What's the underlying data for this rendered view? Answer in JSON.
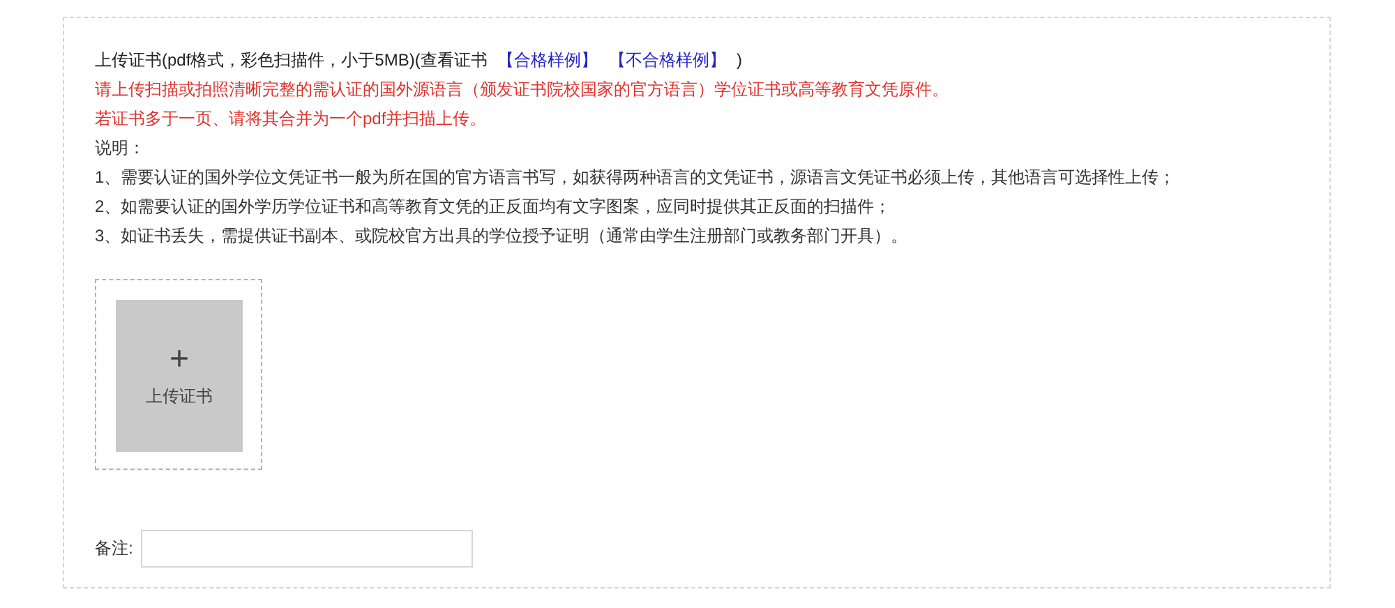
{
  "header": {
    "text": "上传证书(pdf格式，彩色扫描件，小于5MB)(查看证书",
    "links": [
      "【合格样例】",
      "【不合格样例】"
    ],
    "closing": ")"
  },
  "warnings": [
    "请上传扫描或拍照清晰完整的需认证的国外源语言（颁发证书院校国家的官方语言）学位证书或高等教育文凭原件。",
    "若证书多于一页、请将其合并为一个pdf并扫描上传。"
  ],
  "notes_title": "说明：",
  "notes": [
    "1、需要认证的国外学位文凭证书一般为所在国的官方语言书写，如获得两种语言的文凭证书，源语言文凭证书必须上传，其他语言可选择性上传；",
    "2、如需要认证的国外学历学位证书和高等教育文凭的正反面均有文字图案，应同时提供其正反面的扫描件；",
    "3、如证书丢失，需提供证书副本、或院校官方出具的学位授予证明（通常由学生注册部门或教务部门开具）。"
  ],
  "upload": {
    "icon": "+",
    "label": "上传证书"
  },
  "remark": {
    "label": "备注:"
  }
}
